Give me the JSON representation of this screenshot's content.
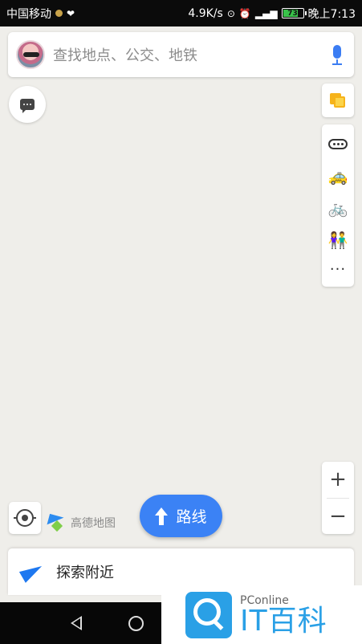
{
  "status_bar": {
    "carrier": "中国移动",
    "speed": "4.9K/s",
    "battery": "73",
    "time": "晚上7:13"
  },
  "search": {
    "placeholder": "查找地点、公交、地铁"
  },
  "right_controls": {
    "modes": [
      {
        "name": "bus-icon"
      },
      {
        "name": "car-icon"
      },
      {
        "name": "bike-icon"
      },
      {
        "name": "walk-icon"
      },
      {
        "name": "more-icon",
        "label": "···"
      }
    ]
  },
  "zoom": {
    "in_label": "+",
    "out_label": "−"
  },
  "logo": {
    "text": "高德地图"
  },
  "route_button": {
    "label": "路线"
  },
  "explore": {
    "label": "探索附近"
  },
  "watermark": {
    "small": "PConline",
    "big": "IT百科"
  },
  "colors": {
    "accent_blue": "#3b82f5",
    "bike_orange": "#f0a21a",
    "layer_yellow": "#f6b31a",
    "map_bg": "#efeeea"
  }
}
